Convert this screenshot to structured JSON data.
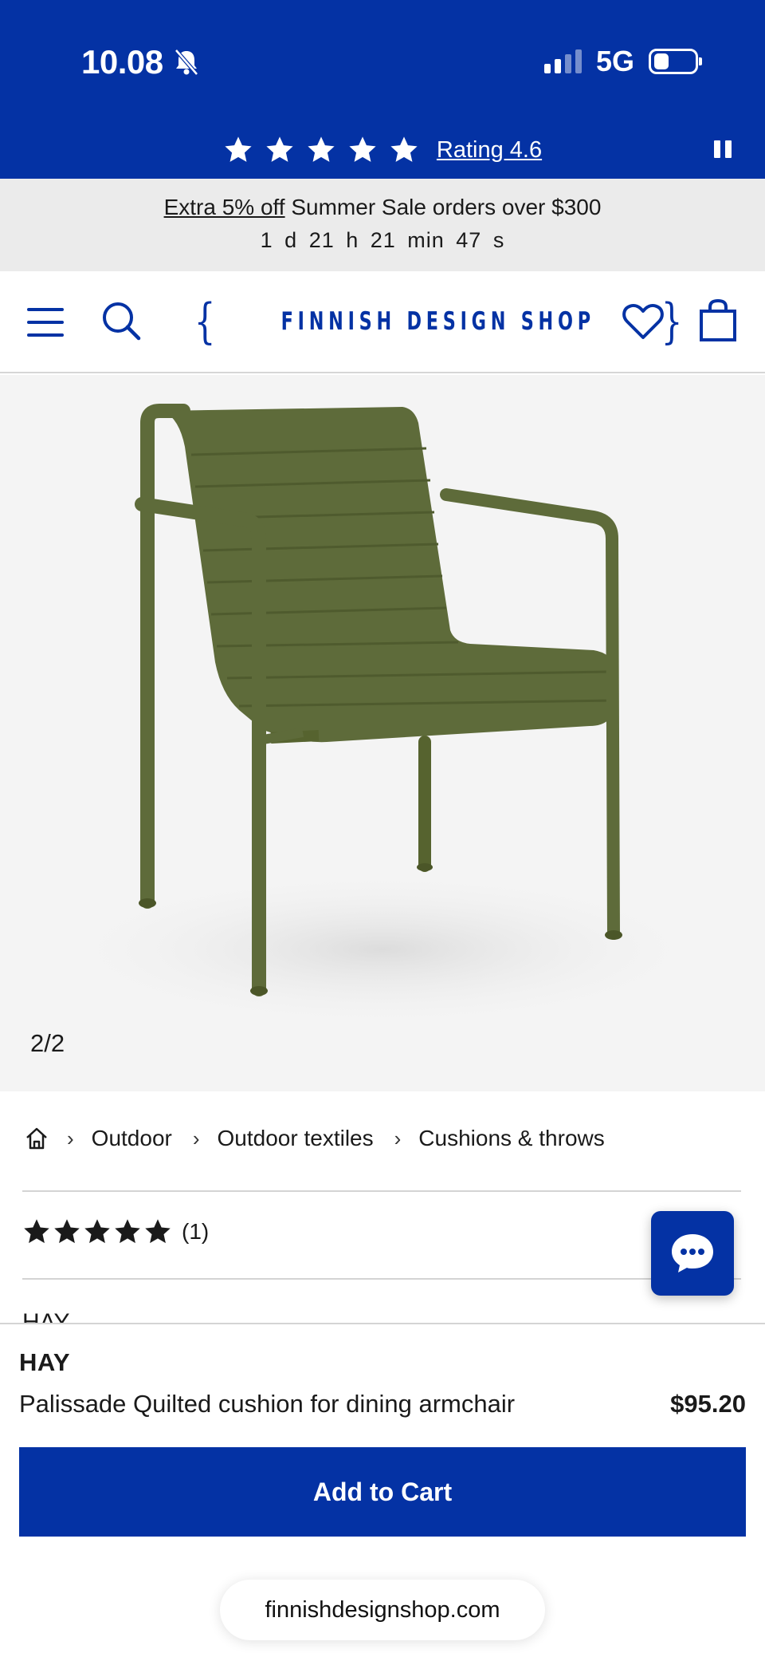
{
  "status_bar": {
    "time": "10.08",
    "network": "5G"
  },
  "rating_banner": {
    "stars": 5,
    "rating_label": "Rating 4.6"
  },
  "promo": {
    "link_text": "Extra 5% off",
    "text": "Summer Sale orders over $300",
    "countdown": "1 d 21 h 21 min 47 s"
  },
  "header": {
    "logo_text": "FINNISH DESIGN SHOP",
    "logo_brace_left": "{",
    "logo_brace_right": "}"
  },
  "gallery": {
    "counter": "2/2"
  },
  "breadcrumb": {
    "items": [
      {
        "label": "Outdoor"
      },
      {
        "label": "Outdoor textiles"
      },
      {
        "label": "Cushions & throws"
      }
    ],
    "separator": "›"
  },
  "reviews": {
    "stars": 5,
    "count": "(1)"
  },
  "brand_peek": "HAY",
  "sticky_bar": {
    "brand": "HAY",
    "product_name": "Palissade Quilted cushion for dining armchair",
    "price": "$95.20",
    "cta_label": "Add to Cart"
  },
  "browser": {
    "url": "finnishdesignshop.com"
  },
  "colors": {
    "brand_blue": "#0432a4",
    "promo_bg": "#ebebeb",
    "chair_green": "#5e6b3a"
  }
}
